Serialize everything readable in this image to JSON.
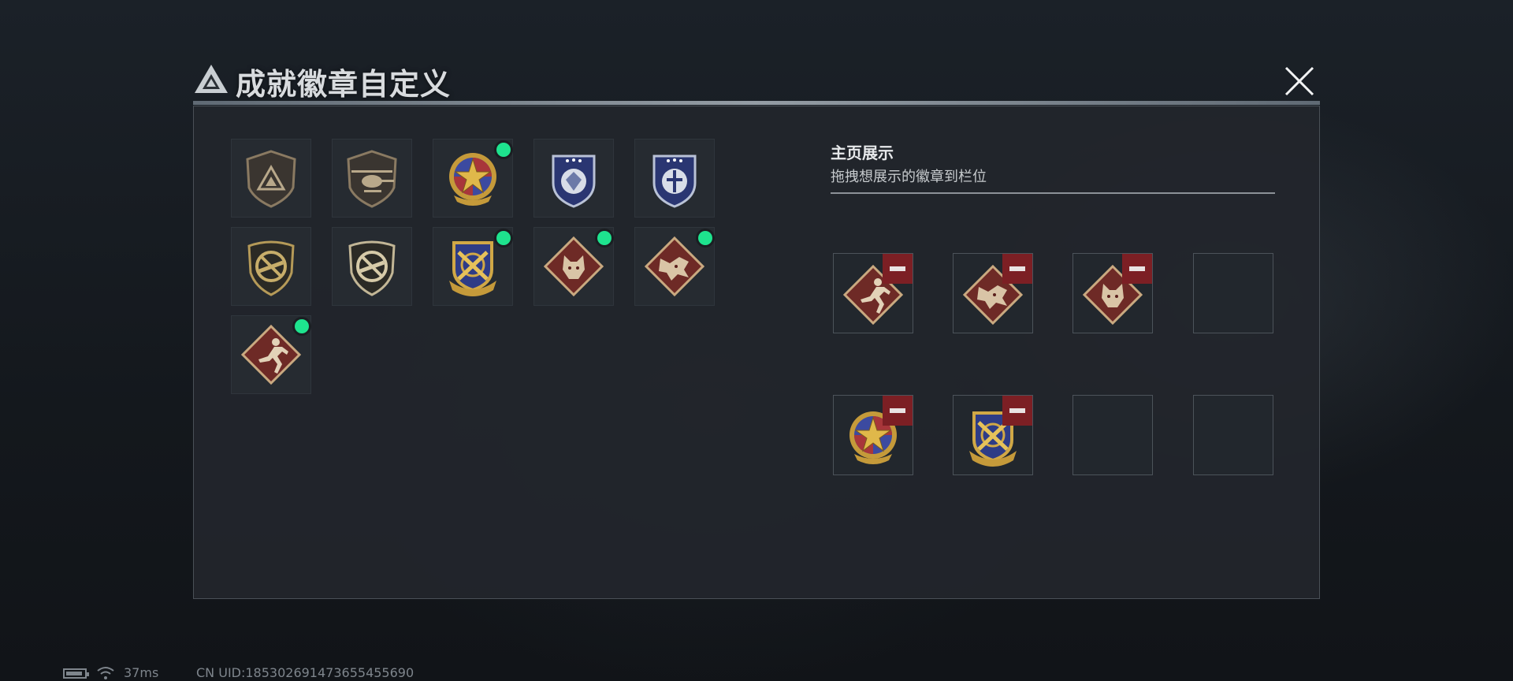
{
  "header": {
    "title": "成就徽章自定义"
  },
  "badges": [
    {
      "id": "b1",
      "icon": "triangle-logo-shield-badge-icon",
      "new": false
    },
    {
      "id": "b2",
      "icon": "helicopter-shield-badge-icon",
      "new": false
    },
    {
      "id": "b3",
      "icon": "gold-star-medal-badge-icon",
      "new": true
    },
    {
      "id": "b4",
      "icon": "diamond-blue-shield-badge-icon",
      "new": false
    },
    {
      "id": "b5",
      "icon": "rifle-blue-shield-badge-icon",
      "new": false
    },
    {
      "id": "b6",
      "icon": "no-rifle-gold-shield-badge-icon",
      "new": false
    },
    {
      "id": "b7",
      "icon": "no-rifle-silver-shield-badge-icon",
      "new": false
    },
    {
      "id": "b8",
      "icon": "crossed-rifles-gold-crest-badge-icon",
      "new": true
    },
    {
      "id": "b9",
      "icon": "wolf-diamond-badge-icon",
      "new": true
    },
    {
      "id": "b10",
      "icon": "dragon-diamond-badge-icon",
      "new": true
    },
    {
      "id": "b11",
      "icon": "runner-diamond-badge-icon",
      "new": true
    }
  ],
  "showcase": {
    "title": "主页展示",
    "subtitle": "拖拽想展示的徽章到栏位",
    "slots": [
      {
        "icon": "runner-diamond-badge-icon",
        "filled": true
      },
      {
        "icon": "dragon-diamond-badge-icon",
        "filled": true
      },
      {
        "icon": "wolf-diamond-badge-icon",
        "filled": true
      },
      {
        "icon": "",
        "filled": false
      },
      {
        "icon": "gold-star-medal-badge-icon",
        "filled": true
      },
      {
        "icon": "crossed-rifles-gold-crest-badge-icon",
        "filled": true
      },
      {
        "icon": "",
        "filled": false
      },
      {
        "icon": "",
        "filled": false
      }
    ]
  },
  "status_bar": {
    "ping": "37ms",
    "uid": "CN UID:18530269147365545569​0"
  },
  "colors": {
    "new_dot": "#1ee38e",
    "remove": "#7c1f24",
    "panel": "#22262c"
  }
}
